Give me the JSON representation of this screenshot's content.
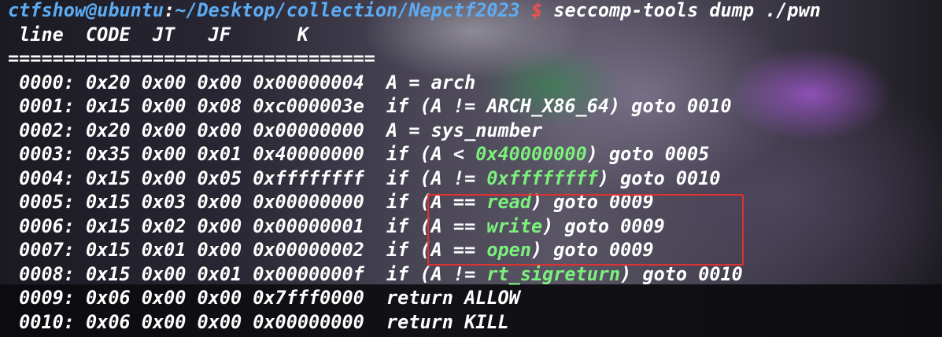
{
  "terminal": {
    "prompt": {
      "user_host": "ctfshow@ubuntu",
      "colon": ":",
      "path": "~/Desktop/collection/Nepctf2023",
      "dollar": "$",
      "command": " seccomp-tools dump ./pwn"
    },
    "header": " line  CODE  JT   JF      K",
    "separator": "=================================",
    "rows": [
      {
        "prefix": " 0000: 0x20 0x00 0x00 0x00000004  A = arch",
        "hl": "",
        "suffix": ""
      },
      {
        "prefix": " 0001: 0x15 0x00 0x08 0xc000003e  if (A != ARCH_X86_64) goto 0010",
        "hl": "",
        "suffix": ""
      },
      {
        "prefix": " 0002: 0x20 0x00 0x00 0x00000000  A = sys_number",
        "hl": "",
        "suffix": ""
      },
      {
        "prefix": " 0003: 0x35 0x00 0x01 0x40000000  if (A < ",
        "hl": "0x40000000",
        "suffix": ") goto 0005"
      },
      {
        "prefix": " 0004: 0x15 0x00 0x05 0xffffffff  if (A != ",
        "hl": "0xffffffff",
        "suffix": ") goto 0010"
      },
      {
        "prefix": " 0005: 0x15 0x03 0x00 0x00000000  if (A == ",
        "hl": "read",
        "suffix": ") goto 0009"
      },
      {
        "prefix": " 0006: 0x15 0x02 0x00 0x00000001  if (A == ",
        "hl": "write",
        "suffix": ") goto 0009"
      },
      {
        "prefix": " 0007: 0x15 0x01 0x00 0x00000002  if (A == ",
        "hl": "open",
        "suffix": ") goto 0009"
      },
      {
        "prefix": " 0008: 0x15 0x00 0x01 0x0000000f  if (A != ",
        "hl": "rt_sigreturn",
        "suffix": ") goto 0010"
      },
      {
        "prefix": " 0009: 0x06 0x00 0x00 0x7fff0000  return ALLOW",
        "hl": "",
        "suffix": ""
      },
      {
        "prefix": " 0010: 0x06 0x00 0x00 0x00000000  return KILL",
        "hl": "",
        "suffix": ""
      }
    ]
  },
  "colors": {
    "prompt": "#5dacf3",
    "dollar": "#f05050",
    "highlight": "#7cf07c",
    "box": "#e03030"
  }
}
